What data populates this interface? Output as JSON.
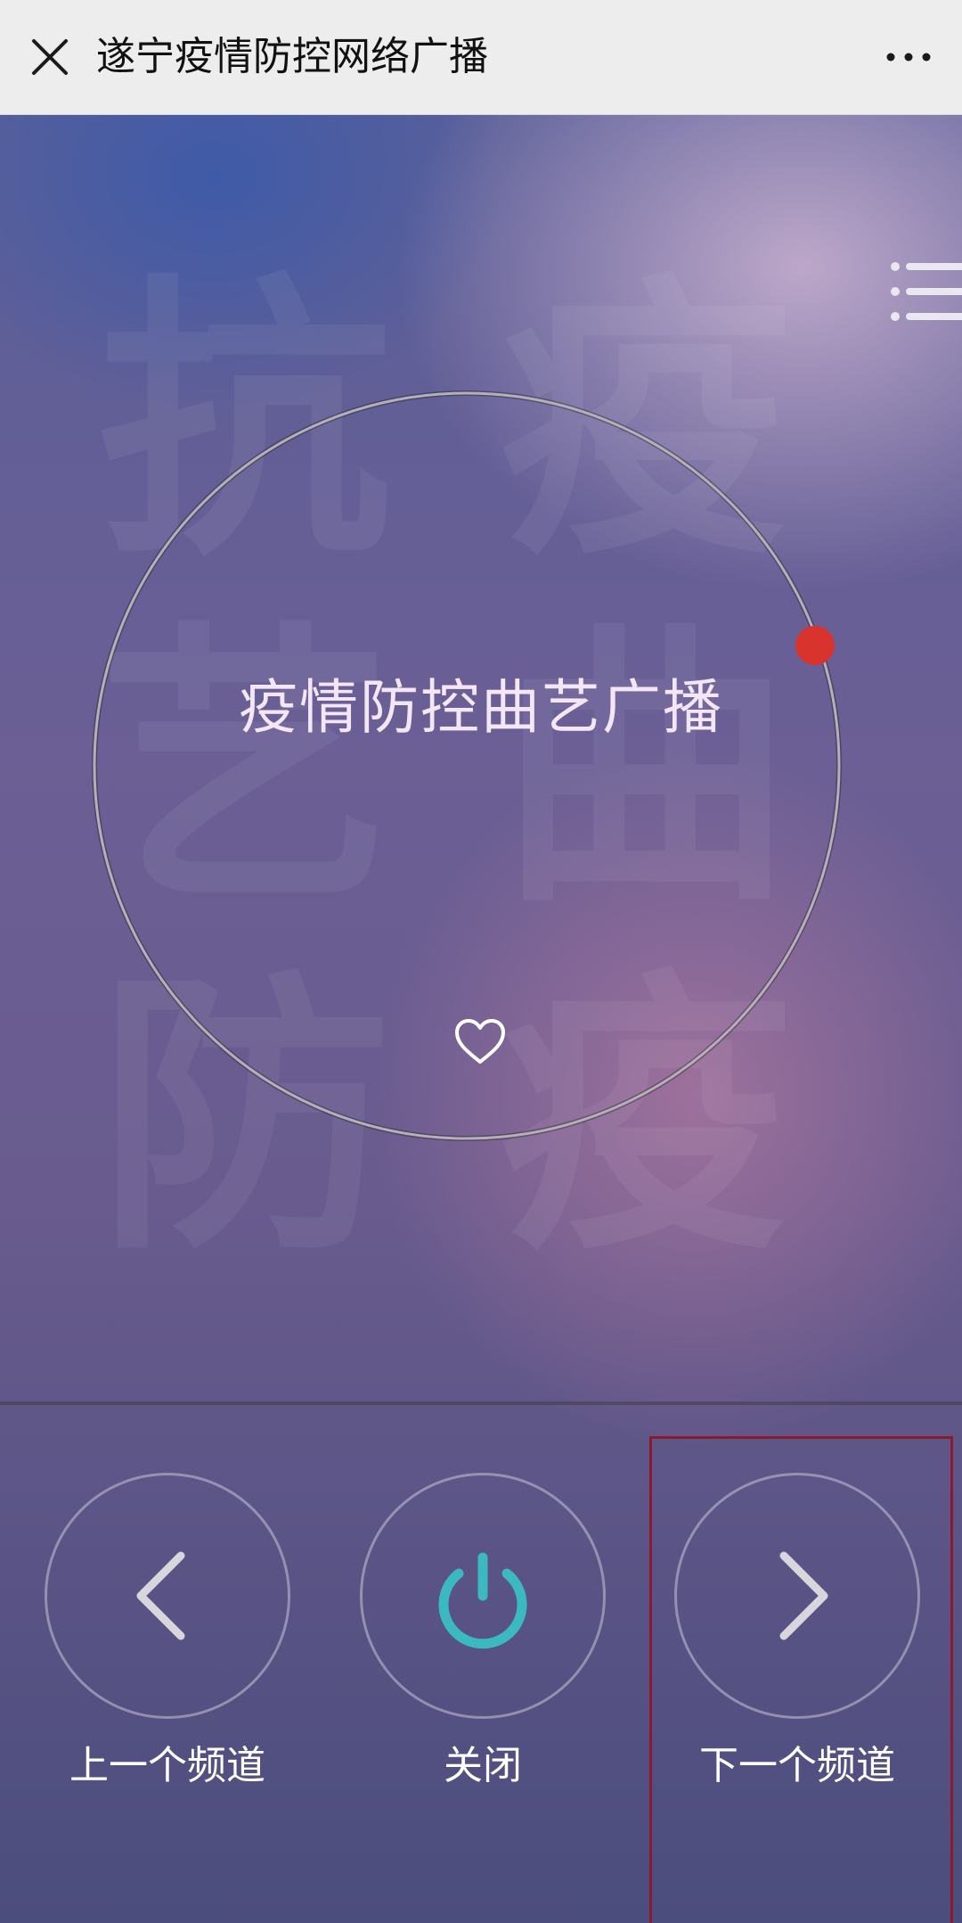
{
  "topbar": {
    "title": "遂宁疫情防控网络广播",
    "close_icon": "close-icon",
    "more_icon": "more-icon"
  },
  "watermark": {
    "chars": [
      "抗",
      "疫",
      "艺",
      "曲",
      "防",
      "疫"
    ]
  },
  "player": {
    "channel_name": "疫情防控曲艺广播",
    "favorite_icon": "heart-icon",
    "menu_icon": "list-menu-icon",
    "progress_dot_color": "#d9332e"
  },
  "controls": {
    "prev_label": "上一个频道",
    "power_label": "关闭",
    "next_label": "下一个频道",
    "power_color": "#3cb8c0"
  }
}
